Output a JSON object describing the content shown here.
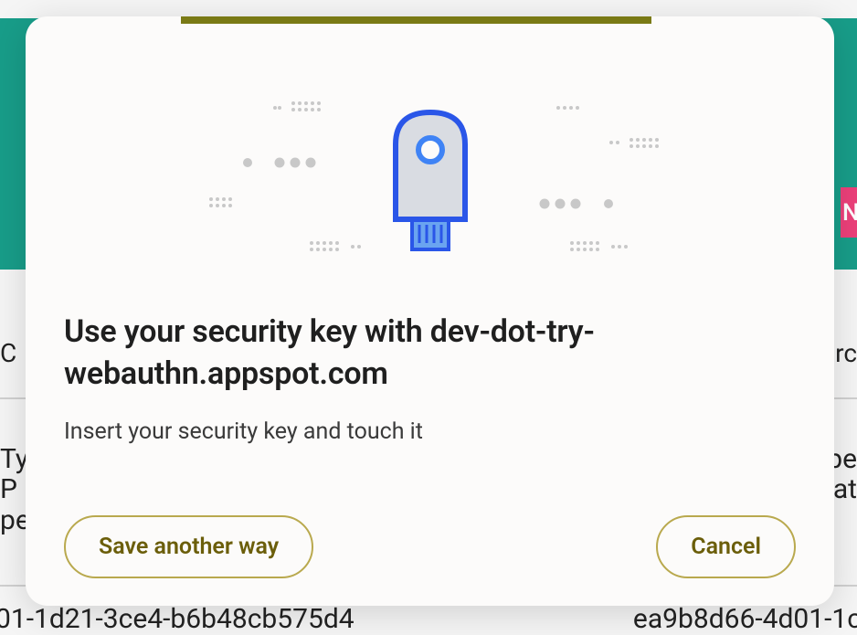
{
  "background": {
    "pink_badge": "N",
    "text_left_1": "C",
    "text_right_1": "rc",
    "text_left_2": "Ty",
    "text_left_3": " P",
    "text_left_4": "pe",
    "text_right_2": "pe",
    "text_right_3": "at",
    "text_bottom_left": "01-1d21-3ce4-b6b48cb575d4",
    "text_bottom_right": "ea9b8d66-4d01-1c"
  },
  "dialog": {
    "title": "Use your security key with dev-dot-try-webauthn.appspot.com",
    "subtitle": "Insert your security key and touch it",
    "buttons": {
      "save_another_way": "Save another way",
      "cancel": "Cancel"
    }
  }
}
